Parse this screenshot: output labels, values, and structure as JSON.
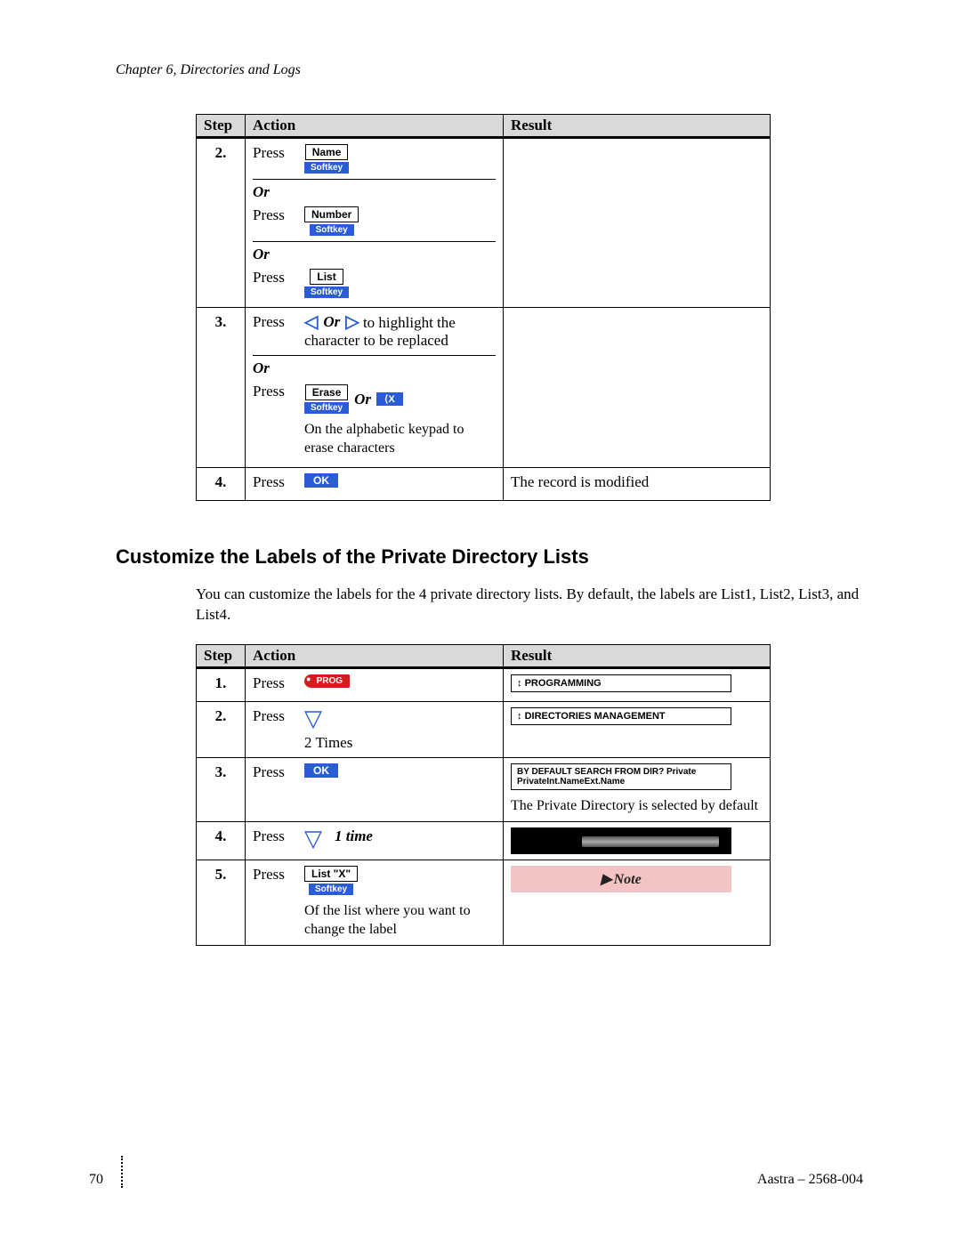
{
  "chapter_header": "Chapter 6, Directories and Logs",
  "table_headers": {
    "step": "Step",
    "action": "Action",
    "result": "Result"
  },
  "press": "Press",
  "or": "Or",
  "softkey": "Softkey",
  "table1": {
    "row2": {
      "step": "2.",
      "btn_name": "Name",
      "btn_number": "Number",
      "btn_list": "List"
    },
    "row3": {
      "step": "3.",
      "highlight_text": "to highlight the character to be replaced",
      "btn_erase": "Erase",
      "backspace": "X",
      "erase_text": "On the alphabetic keypad to erase characters",
      "inline_or": "Or"
    },
    "row4": {
      "step": "4.",
      "ok": "OK",
      "result": "The record is modified"
    }
  },
  "section_title": "Customize the Labels of the Private Directory Lists",
  "section_body": "You can customize the labels for the 4 private directory lists.  By default, the labels are List1, List2, List3, and List4.",
  "table2": {
    "row1": {
      "step": "1.",
      "prog": "PROG",
      "screen": "PROGRAMMING"
    },
    "row2": {
      "step": "2.",
      "times": "2 Times",
      "screen": "DIRECTORIES MANAGEMENT"
    },
    "row3": {
      "step": "3.",
      "ok": "OK",
      "screen_line1": "BY DEFAULT SEARCH FROM DIR?   Private",
      "screen_line2": "PrivateInt.NameExt.Name",
      "result_text": "The Private Directory is selected by default"
    },
    "row4": {
      "step": "4.",
      "one_time": "1 time"
    },
    "row5": {
      "step": "5.",
      "btn_listx": "List \"X\"",
      "of_text": "Of the list where you want to change the label",
      "note": "Note"
    }
  },
  "footer": {
    "page_number": "70",
    "doc_ref": "Aastra – 2568-004"
  }
}
